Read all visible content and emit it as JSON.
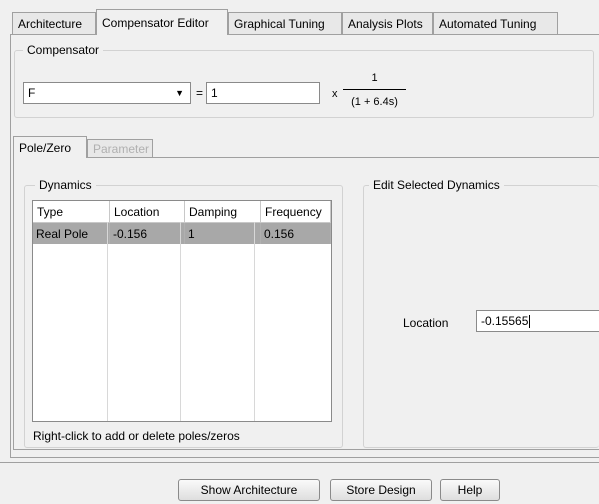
{
  "tabs": [
    {
      "label": "Architecture"
    },
    {
      "label": "Compensator Editor",
      "active": true
    },
    {
      "label": "Graphical Tuning"
    },
    {
      "label": "Analysis Plots"
    },
    {
      "label": "Automated Tuning"
    }
  ],
  "compensator": {
    "title": "Compensator",
    "selected": "F",
    "equals": "=",
    "gain": "1",
    "times": "x",
    "numerator": "1",
    "denominator": "(1 + 6.4s)"
  },
  "subtabs": [
    {
      "label": "Pole/Zero",
      "active": true
    },
    {
      "label": "Parameter",
      "enabled": false
    }
  ],
  "dynamics": {
    "title": "Dynamics",
    "columns": [
      "Type",
      "Location",
      "Damping",
      "Frequency"
    ],
    "rows": [
      {
        "type": "Real Pole",
        "location": "-0.156",
        "damping": "1",
        "frequency": "0.156",
        "selected": true
      }
    ],
    "hint": "Right-click to add or delete poles/zeros"
  },
  "edit": {
    "title": "Edit Selected Dynamics",
    "location_label": "Location",
    "location_value": "-0.15565"
  },
  "buttons": {
    "show_architecture": "Show Architecture",
    "store_design": "Store Design",
    "help": "Help"
  }
}
